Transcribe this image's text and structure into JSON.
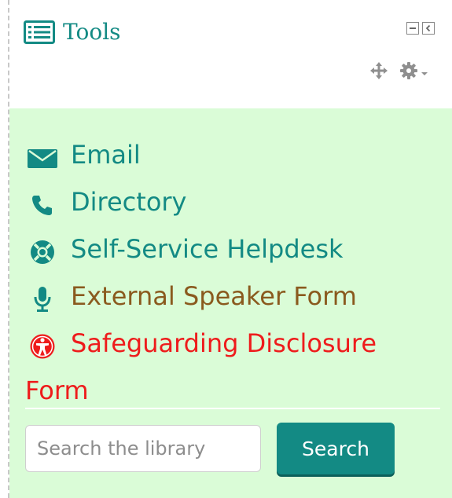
{
  "block": {
    "title": "Tools",
    "title_icon": "list-icon",
    "controls": [
      "minimize-icon",
      "dock-icon"
    ],
    "actions": [
      "move-icon",
      "gear-icon",
      "caret-down-icon"
    ]
  },
  "links": [
    {
      "label": "Email",
      "icon": "envelope-icon",
      "color": "#138a84"
    },
    {
      "label": "Directory",
      "icon": "phone-icon",
      "color": "#138a84"
    },
    {
      "label": "Self-Service Helpdesk",
      "icon": "lifebuoy-icon",
      "color": "#138a84"
    },
    {
      "label": "External Speaker Form",
      "icon": "microphone-icon",
      "color": "#8a5a1e"
    },
    {
      "label": "Safeguarding Disclosure Form",
      "icon": "accessibility-icon",
      "color": "#ee1c1c"
    }
  ],
  "search": {
    "placeholder": "Search the library",
    "value": "",
    "button_label": "Search"
  },
  "colors": {
    "accent": "#138a84",
    "panel_bg": "#dafcd7",
    "danger": "#ee1c1c"
  }
}
